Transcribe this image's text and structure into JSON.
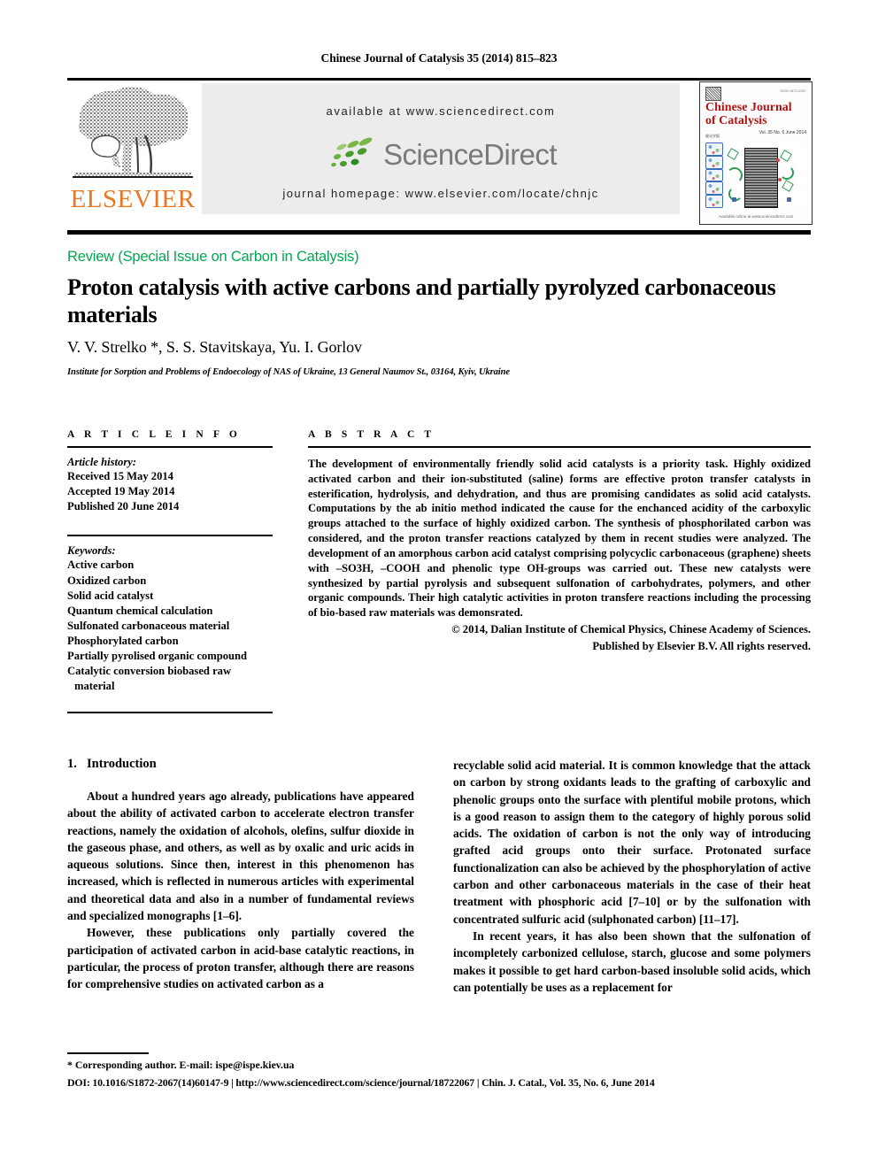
{
  "running_head": "Chinese Journal of Catalysis 35 (2014) 815–823",
  "header": {
    "publisher_wordmark": "ELSEVIER",
    "available_at": "available at www.sciencedirect.com",
    "sciencedirect_wordmark": "ScienceDirect",
    "journal_homepage": "journal homepage: www.elsevier.com/locate/chnjc",
    "cover": {
      "title_line1": "Chinese Journal",
      "title_line2": "of Catalysis",
      "issn_note": "ISSN 1872-2067",
      "masthead_note": "催化学报",
      "volume_note": "Vol. 35 No. 6 June 2014",
      "footer_note": "Available online at www.sciencedirect.com"
    }
  },
  "article": {
    "doc_type": "Review (Special Issue on Carbon in Catalysis)",
    "title": "Proton catalysis with active carbons and partially pyrolyzed carbonaceous materials",
    "authors": "V. V. Strelko *, S. S. Stavitskaya, Yu. I. Gorlov",
    "affiliation": "Institute for Sorption and Problems of Endoecology of NAS of Ukraine, 13 General Naumov St., 03164, Kyiv, Ukraine"
  },
  "info": {
    "section_label": "A R T I C L E    I N F O",
    "history_title": "Article history:",
    "history": [
      "Received 15 May 2014",
      "Accepted 19 May 2014",
      "Published 20 June 2014"
    ],
    "keywords_title": "Keywords:",
    "keywords": [
      "Active carbon",
      "Oxidized carbon",
      "Solid acid catalyst",
      "Quantum chemical calculation",
      "Sulfonated carbonaceous material",
      "Phosphorylated carbon",
      "Partially pyrolised organic compound"
    ],
    "keyword_last": "Catalytic conversion biobased raw",
    "keyword_last_cont": "material"
  },
  "abstract": {
    "section_label": "A B S T R A C T",
    "text": "The development of environmentally friendly solid acid catalysts is a priority task. Highly oxidized activated carbon and their ion-substituted (saline) forms are effective proton transfer catalysts in esterification, hydrolysis, and dehydration, and thus are promising candidates as solid acid catalysts. Computations by the ab initio method indicated the cause for the enchanced acidity of the carboxylic groups attached to the surface of highly oxidized carbon. The synthesis of phosphorilated carbon was considered, and the proton transfer reactions catalyzed by them in recent studies were analyzed. The development of an amorphous carbon acid catalyst comprising polycyclic carbonaceous (graphene) sheets with –SO3H, –COOH and phenolic type OH-groups was carried out. These new catalysts were synthesized by partial pyrolysis and subsequent sulfonation of carbohydrates, polymers, and other organic compounds. Their high catalytic activities in proton transfere reactions including the processing of bio-based raw materials was demonsrated.",
    "copyright_line1": "© 2014, Dalian Institute of Chemical Physics, Chinese Academy of Sciences.",
    "copyright_line2": "Published by Elsevier B.V. All rights reserved."
  },
  "body": {
    "section_number": "1.",
    "section_title": "Introduction",
    "left_paragraphs": [
      "About a hundred years ago already, publications have appeared about the ability of activated carbon to accelerate electron transfer reactions, namely the oxidation of alcohols, olefins, sulfur dioxide in the gaseous phase, and others, as well as by oxalic and uric acids in aqueous solutions. Since then, interest in this phenomenon has increased, which is reflected in numerous articles with experimental and theoretical data and also in a number of fundamental reviews and specialized monographs [1–6].",
      "However, these publications only partially covered the participation of activated carbon in acid-base catalytic reactions, in particular, the process of proton transfer, although there are reasons for comprehensive studies on activated carbon as a"
    ],
    "right_paragraphs": [
      "recyclable solid acid material. It is common knowledge that the attack on carbon by strong oxidants leads to the grafting of carboxylic and phenolic groups onto the surface with plentiful mobile protons, which is a good reason to assign them to the category of highly porous solid acids. The oxidation of carbon is not the only way of introducing grafted acid groups onto their surface. Protonated surface functionalization can also be achieved by the phosphorylation of active carbon and other carbonaceous materials in the case of their heat treatment with phosphoric acid [7–10] or by the sulfonation with concentrated sulfuric acid (sulphonated carbon) [11–17].",
      "In recent years, it has also been shown that the sulfonation of incompletely carbonized cellulose, starch, glucose and some polymers makes it possible to get hard carbon-based insoluble solid acids, which can potentially be uses as a replacement for"
    ]
  },
  "footnotes": {
    "corresponding": "* Corresponding author. E-mail: ispe@ispe.kiev.ua",
    "doi_line": "DOI: 10.1016/S1872-2067(14)60147-9 | http://www.sciencedirect.com/science/journal/18722067 | Chin. J. Catal., Vol. 35, No. 6, June 2014"
  },
  "colors": {
    "elsevier_orange": "#E87722",
    "doctype_green": "#00A651",
    "sciencedirect_gray": "#7a7a7a",
    "band_gray": "#ececec",
    "cover_red": "#b01414"
  }
}
